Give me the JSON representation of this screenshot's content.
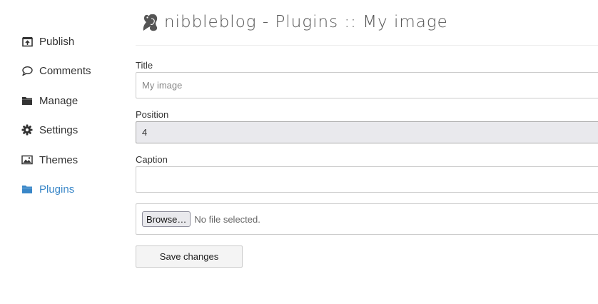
{
  "header": {
    "title": "nibbleblog - Plugins :: My image",
    "logo_icon": "squirrel-logo-icon"
  },
  "sidebar": {
    "active_color": "#3a87c8",
    "items": [
      {
        "label": "Publish",
        "icon": "publish-icon"
      },
      {
        "label": "Comments",
        "icon": "comment-icon"
      },
      {
        "label": "Manage",
        "icon": "folder-icon"
      },
      {
        "label": "Settings",
        "icon": "gear-icon"
      },
      {
        "label": "Themes",
        "icon": "image-icon"
      },
      {
        "label": "Plugins",
        "icon": "folder-icon",
        "active": true
      }
    ]
  },
  "form": {
    "title_label": "Title",
    "title_placeholder": "My image",
    "title_value": "",
    "position_label": "Position",
    "position_value": "4",
    "caption_label": "Caption",
    "caption_value": "",
    "browse_label": "Browse…",
    "file_status": "No file selected.",
    "save_label": "Save changes"
  }
}
